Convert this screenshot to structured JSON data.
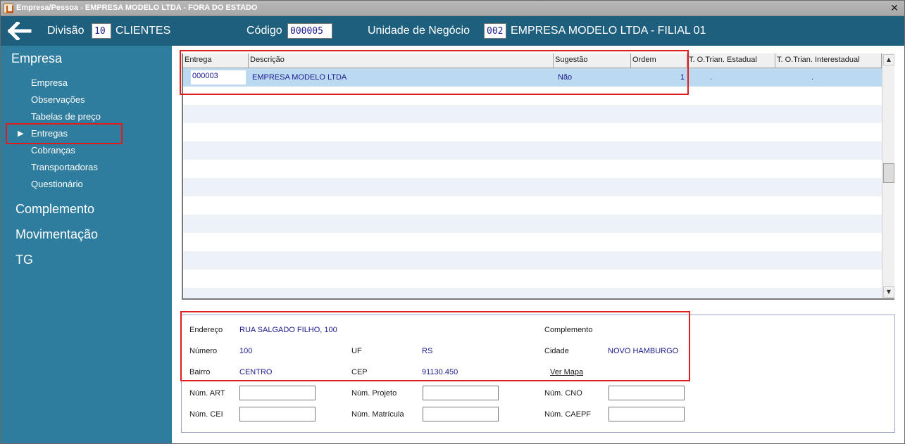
{
  "window": {
    "title": "Empresa/Pessoa - EMPRESA MODELO LTDA - FORA DO ESTADO",
    "close_glyph": "✕"
  },
  "header": {
    "divisao_label": "Divisão",
    "divisao_value": "10",
    "divisao_name": "CLIENTES",
    "codigo_label": "Código",
    "codigo_value": "000005",
    "unidade_label": "Unidade de Negócio",
    "unidade_value": "002",
    "unidade_name": "EMPRESA MODELO LTDA - FILIAL 01"
  },
  "sidebar": {
    "section_empresa": "Empresa",
    "items": [
      {
        "label": "Empresa"
      },
      {
        "label": "Observações"
      },
      {
        "label": "Tabelas de preço"
      },
      {
        "label": "Entregas",
        "selected": true
      },
      {
        "label": "Cobranças"
      },
      {
        "label": "Transportadoras"
      },
      {
        "label": "Questionário"
      }
    ],
    "section_complemento": "Complemento",
    "section_movimentacao": "Movimentação",
    "section_tg": "TG",
    "selected_arrow": "▶"
  },
  "grid": {
    "columns": [
      {
        "label": "Entrega"
      },
      {
        "label": "Descrição"
      },
      {
        "label": "Sugestão"
      },
      {
        "label": "Ordem"
      },
      {
        "label": "T. O.Trian. Estadual"
      },
      {
        "label": "T. O.Trian. Interestadual"
      }
    ],
    "rows": [
      {
        "entrega": "000003",
        "descricao": "EMPRESA MODELO LTDA",
        "sugestao": "Não",
        "ordem": "1",
        "estadual": ".",
        "interestadual": "."
      }
    ]
  },
  "address": {
    "endereco_label": "Endereço",
    "endereco_value": "RUA SALGADO FILHO, 100",
    "complemento_label": "Complemento",
    "numero_label": "Número",
    "numero_value": "100",
    "uf_label": "UF",
    "uf_value": "RS",
    "cidade_label": "Cidade",
    "cidade_value": "NOVO HAMBURGO",
    "bairro_label": "Bairro",
    "bairro_value": "CENTRO",
    "cep_label": "CEP",
    "cep_value": "91130.450",
    "ver_mapa": "Ver Mapa",
    "num_art_label": "Núm. ART",
    "num_projeto_label": "Núm. Projeto",
    "num_cno_label": "Núm. CNO",
    "num_cei_label": "Núm. CEI",
    "num_matricula_label": "Núm. Matrícula",
    "num_caepf_label": "Núm. CAEPF"
  },
  "colors": {
    "header_bg": "#1f5f7e",
    "sidebar_bg": "#2e7c9e",
    "highlight_red": "#e01d1d",
    "value_blue": "#1a1a8c",
    "selected_row": "#bcd9f2"
  }
}
